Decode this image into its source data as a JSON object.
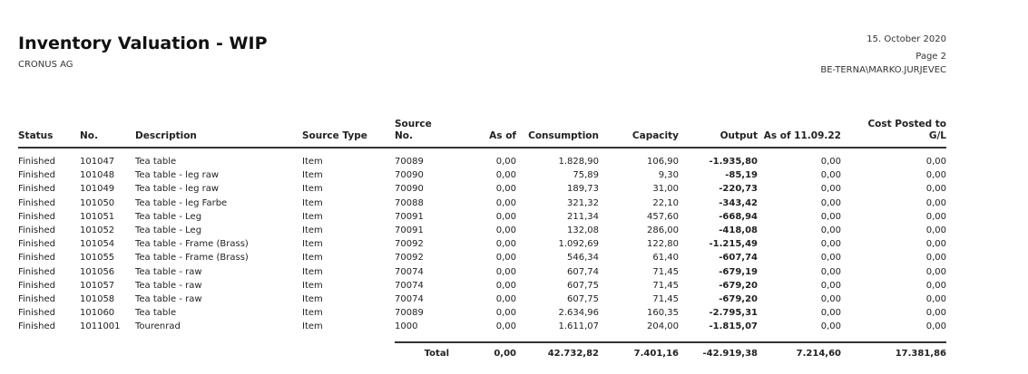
{
  "header": {
    "title": "Inventory Valuation - WIP",
    "company": "CRONUS AG",
    "date": "15. October 2020",
    "page": "Page 2",
    "user": "BE-TERNA\\MARKO.JURJEVEC"
  },
  "columns": {
    "status": "Status",
    "no": "No.",
    "description": "Description",
    "source_type": "Source Type",
    "source_no_line1": "Source",
    "source_no_line2": "No.",
    "as_of": "As of",
    "consumption": "Consumption",
    "capacity": "Capacity",
    "output": "Output",
    "as_of_date": "As of 11.09.22",
    "cost_posted_line1": "Cost Posted to",
    "cost_posted_line2": "G/L"
  },
  "rows": [
    {
      "status": "Finished",
      "no": "101047",
      "description": "Tea table",
      "source_type": "Item",
      "source_no": "70089",
      "as_of": "0,00",
      "consumption": "1.828,90",
      "capacity": "106,90",
      "output": "-1.935,80",
      "as_of_date": "0,00",
      "cost_posted": "0,00"
    },
    {
      "status": "Finished",
      "no": "101048",
      "description": "Tea table - leg raw",
      "source_type": "Item",
      "source_no": "70090",
      "as_of": "0,00",
      "consumption": "75,89",
      "capacity": "9,30",
      "output": "-85,19",
      "as_of_date": "0,00",
      "cost_posted": "0,00"
    },
    {
      "status": "Finished",
      "no": "101049",
      "description": "Tea table - leg raw",
      "source_type": "Item",
      "source_no": "70090",
      "as_of": "0,00",
      "consumption": "189,73",
      "capacity": "31,00",
      "output": "-220,73",
      "as_of_date": "0,00",
      "cost_posted": "0,00"
    },
    {
      "status": "Finished",
      "no": "101050",
      "description": "Tea table - leg Farbe",
      "source_type": "Item",
      "source_no": "70088",
      "as_of": "0,00",
      "consumption": "321,32",
      "capacity": "22,10",
      "output": "-343,42",
      "as_of_date": "0,00",
      "cost_posted": "0,00"
    },
    {
      "status": "Finished",
      "no": "101051",
      "description": "Tea table - Leg",
      "source_type": "Item",
      "source_no": "70091",
      "as_of": "0,00",
      "consumption": "211,34",
      "capacity": "457,60",
      "output": "-668,94",
      "as_of_date": "0,00",
      "cost_posted": "0,00"
    },
    {
      "status": "Finished",
      "no": "101052",
      "description": "Tea table - Leg",
      "source_type": "Item",
      "source_no": "70091",
      "as_of": "0,00",
      "consumption": "132,08",
      "capacity": "286,00",
      "output": "-418,08",
      "as_of_date": "0,00",
      "cost_posted": "0,00"
    },
    {
      "status": "Finished",
      "no": "101054",
      "description": "Tea table - Frame (Brass)",
      "source_type": "Item",
      "source_no": "70092",
      "as_of": "0,00",
      "consumption": "1.092,69",
      "capacity": "122,80",
      "output": "-1.215,49",
      "as_of_date": "0,00",
      "cost_posted": "0,00"
    },
    {
      "status": "Finished",
      "no": "101055",
      "description": "Tea table - Frame (Brass)",
      "source_type": "Item",
      "source_no": "70092",
      "as_of": "0,00",
      "consumption": "546,34",
      "capacity": "61,40",
      "output": "-607,74",
      "as_of_date": "0,00",
      "cost_posted": "0,00"
    },
    {
      "status": "Finished",
      "no": "101056",
      "description": "Tea table - raw",
      "source_type": "Item",
      "source_no": "70074",
      "as_of": "0,00",
      "consumption": "607,74",
      "capacity": "71,45",
      "output": "-679,19",
      "as_of_date": "0,00",
      "cost_posted": "0,00"
    },
    {
      "status": "Finished",
      "no": "101057",
      "description": "Tea table - raw",
      "source_type": "Item",
      "source_no": "70074",
      "as_of": "0,00",
      "consumption": "607,75",
      "capacity": "71,45",
      "output": "-679,20",
      "as_of_date": "0,00",
      "cost_posted": "0,00"
    },
    {
      "status": "Finished",
      "no": "101058",
      "description": "Tea table - raw",
      "source_type": "Item",
      "source_no": "70074",
      "as_of": "0,00",
      "consumption": "607,75",
      "capacity": "71,45",
      "output": "-679,20",
      "as_of_date": "0,00",
      "cost_posted": "0,00"
    },
    {
      "status": "Finished",
      "no": "101060",
      "description": "Tea table",
      "source_type": "Item",
      "source_no": "70089",
      "as_of": "0,00",
      "consumption": "2.634,96",
      "capacity": "160,35",
      "output": "-2.795,31",
      "as_of_date": "0,00",
      "cost_posted": "0,00"
    },
    {
      "status": "Finished",
      "no": "1011001",
      "description": "Tourenrad",
      "source_type": "Item",
      "source_no": "1000",
      "as_of": "0,00",
      "consumption": "1.611,07",
      "capacity": "204,00",
      "output": "-1.815,07",
      "as_of_date": "0,00",
      "cost_posted": "0,00"
    }
  ],
  "total": {
    "label": "Total",
    "as_of": "0,00",
    "consumption": "42.732,82",
    "capacity": "7.401,16",
    "output": "-42.919,38",
    "as_of_date": "7.214,60",
    "cost_posted": "17.381,86"
  }
}
